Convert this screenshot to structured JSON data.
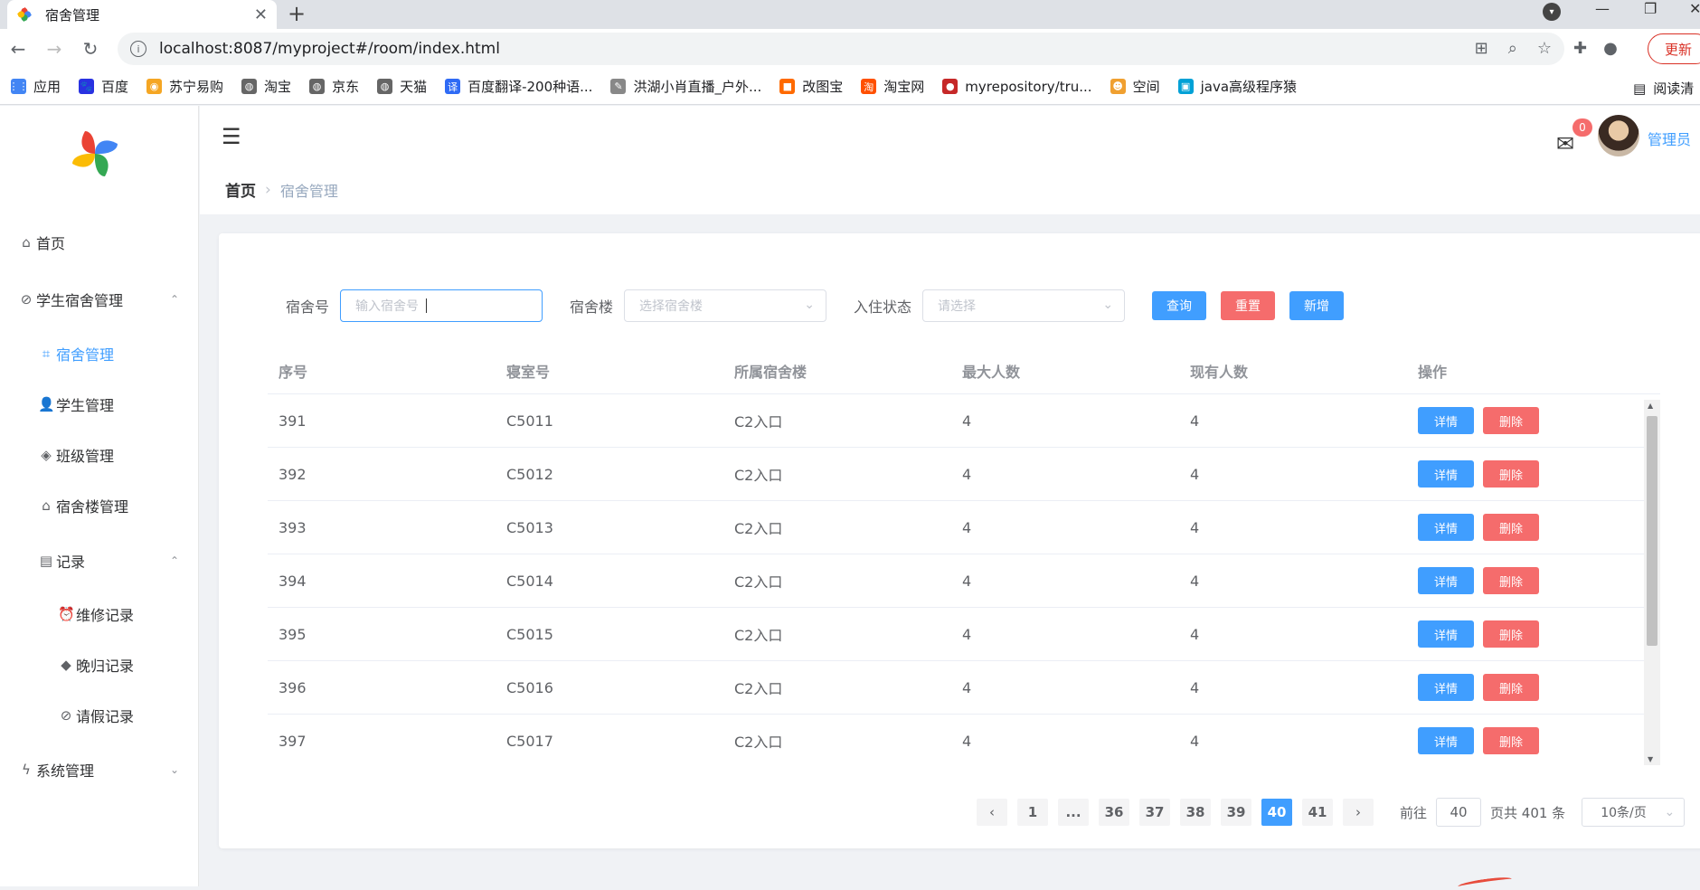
{
  "browser": {
    "tab_title": "宿舍管理",
    "url": "localhost:8087/myproject#/room/index.html",
    "update_label": "更新",
    "bookmarks": [
      {
        "label": "应用",
        "color": "#4285f4",
        "glyph": "⋮⋮"
      },
      {
        "label": "百度",
        "color": "#2932e1",
        "glyph": "🐾"
      },
      {
        "label": "苏宁易购",
        "color": "#f5a623",
        "glyph": "◉"
      },
      {
        "label": "淘宝",
        "color": "#666666",
        "glyph": "◍"
      },
      {
        "label": "京东",
        "color": "#666666",
        "glyph": "◍"
      },
      {
        "label": "天猫",
        "color": "#666666",
        "glyph": "◍"
      },
      {
        "label": "百度翻译-200种语...",
        "color": "#2f6bf5",
        "glyph": "译"
      },
      {
        "label": "洪湖小肖直播_户外...",
        "color": "#888888",
        "glyph": "✎"
      },
      {
        "label": "改图宝",
        "color": "#ff6a00",
        "glyph": "■"
      },
      {
        "label": "淘宝网",
        "color": "#ff5000",
        "glyph": "淘"
      },
      {
        "label": "myrepository/tru...",
        "color": "#c62828",
        "glyph": "●"
      },
      {
        "label": "空间",
        "color": "#f0a030",
        "glyph": "☻"
      },
      {
        "label": "java高级程序猿",
        "color": "#00a1d6",
        "glyph": "▣"
      }
    ],
    "reading_list": "阅读清"
  },
  "sidebar": {
    "items": [
      {
        "label": "首页",
        "icon": "home-icon",
        "glyph": "⌂",
        "indent": 0,
        "caret": "",
        "active": false
      },
      {
        "label": "学生宿舍管理",
        "icon": "paperclip-icon",
        "glyph": "⊘",
        "indent": 0,
        "caret": "⌃",
        "active": false
      },
      {
        "label": "宿舍管理",
        "icon": "crop-icon",
        "glyph": "⌗",
        "indent": 1,
        "caret": "",
        "active": true
      },
      {
        "label": "学生管理",
        "icon": "user-icon",
        "glyph": "👤",
        "indent": 1,
        "caret": "",
        "active": false
      },
      {
        "label": "班级管理",
        "icon": "layers-icon",
        "glyph": "◈",
        "indent": 1,
        "caret": "",
        "active": false
      },
      {
        "label": "宿舍楼管理",
        "icon": "building-icon",
        "glyph": "⌂",
        "indent": 1,
        "caret": "",
        "active": false
      },
      {
        "label": "记录",
        "icon": "document-icon",
        "glyph": "▤",
        "indent": 1,
        "caret": "⌃",
        "active": false
      },
      {
        "label": "维修记录",
        "icon": "alarm-icon",
        "glyph": "⏰",
        "indent": 2,
        "caret": "",
        "active": false
      },
      {
        "label": "晚归记录",
        "icon": "tag-icon",
        "glyph": "◆",
        "indent": 2,
        "caret": "",
        "active": false
      },
      {
        "label": "请假记录",
        "icon": "paperclip-icon",
        "glyph": "⊘",
        "indent": 2,
        "caret": "",
        "active": false
      },
      {
        "label": "系统管理",
        "icon": "lightning-icon",
        "glyph": "ϟ",
        "indent": 0,
        "caret": "⌄",
        "active": false
      }
    ]
  },
  "header": {
    "breadcrumb_home": "首页",
    "breadcrumb_current": "宿舍管理",
    "mail_badge": "0",
    "user_name": "管理员"
  },
  "filters": {
    "room_label": "宿舍号",
    "room_placeholder": "输入宿舍号",
    "building_label": "宿舍楼",
    "building_placeholder": "选择宿舍楼",
    "status_label": "入住状态",
    "status_placeholder": "请选择",
    "search_label": "查询",
    "reset_label": "重置",
    "add_label": "新增"
  },
  "table": {
    "headers": [
      "序号",
      "寝室号",
      "所属宿舍楼",
      "最大人数",
      "现有人数",
      "操作"
    ],
    "detail_label": "详情",
    "delete_label": "删除",
    "rows": [
      [
        "391",
        "C5011",
        "C2入口",
        "4",
        "4"
      ],
      [
        "392",
        "C5012",
        "C2入口",
        "4",
        "4"
      ],
      [
        "393",
        "C5013",
        "C2入口",
        "4",
        "4"
      ],
      [
        "394",
        "C5014",
        "C2入口",
        "4",
        "4"
      ],
      [
        "395",
        "C5015",
        "C2入口",
        "4",
        "4"
      ],
      [
        "396",
        "C5016",
        "C2入口",
        "4",
        "4"
      ],
      [
        "397",
        "C5017",
        "C2入口",
        "4",
        "4"
      ]
    ]
  },
  "pagination": {
    "prev": "‹",
    "next": "›",
    "pages": [
      "1",
      "...",
      "36",
      "37",
      "38",
      "39",
      "40",
      "41"
    ],
    "current": "40",
    "goto_label": "前往",
    "goto_value": "40",
    "total_label": "页共 401 条",
    "page_size": "10条/页"
  },
  "colors": {
    "primary": "#409eff",
    "danger": "#f56c6c"
  }
}
